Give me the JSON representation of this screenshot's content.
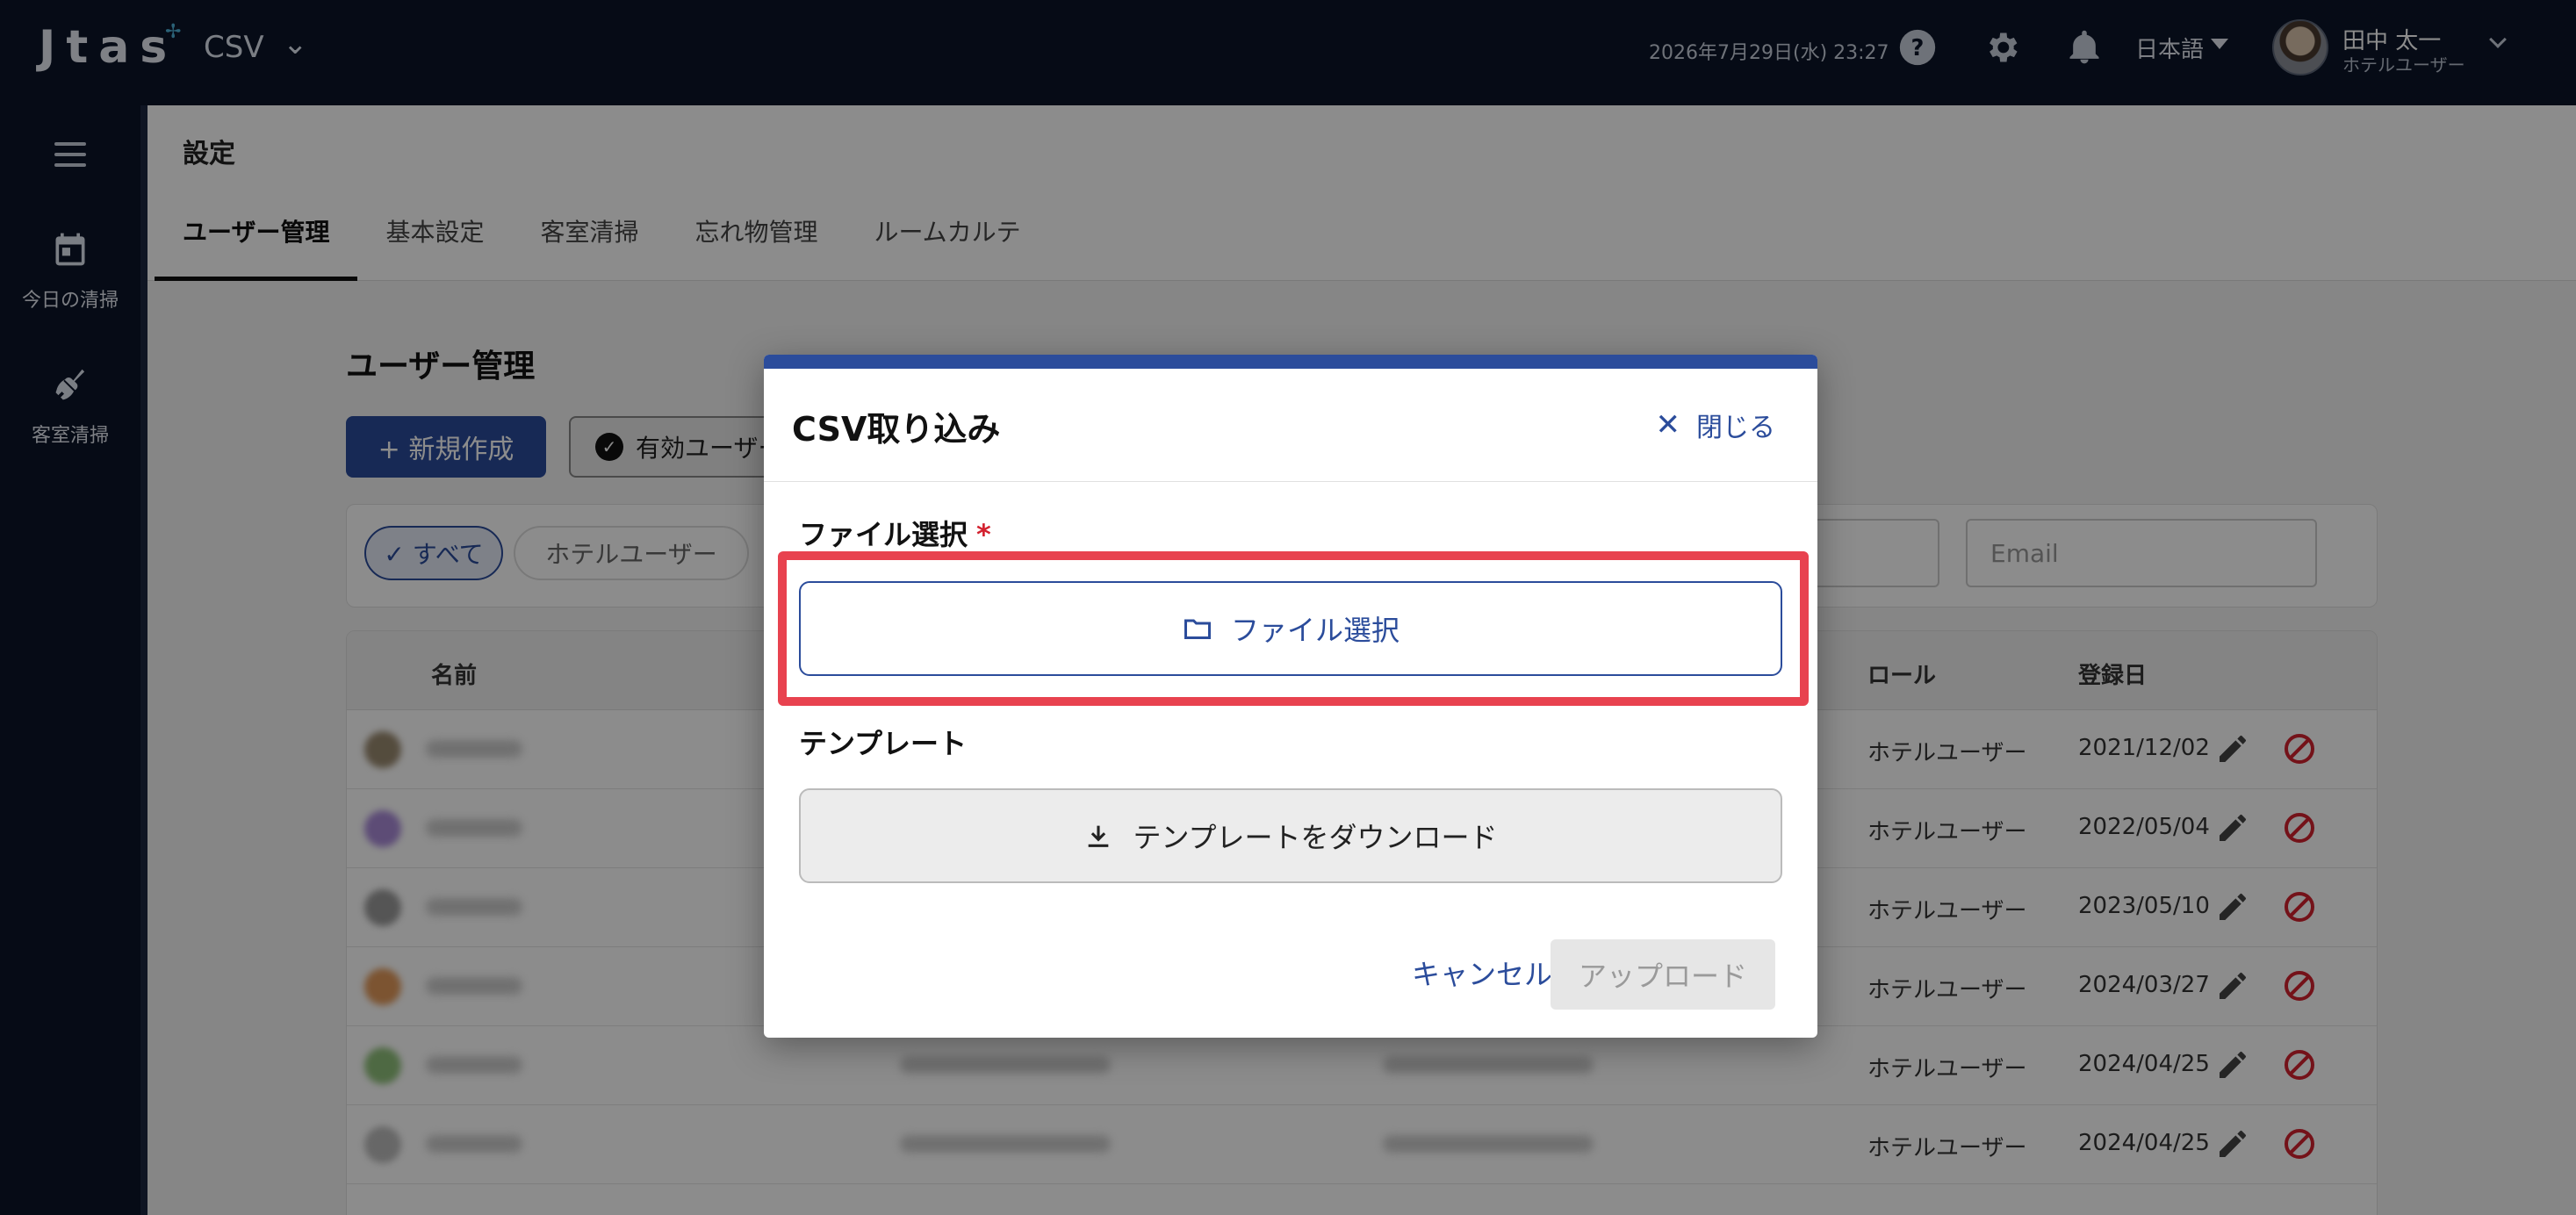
{
  "header": {
    "logo_text": "Jtas",
    "app_name": "CSV",
    "datetime": "2026年7月29日(水) 23:27",
    "language": "日本語",
    "user_name": "田中 太一",
    "user_role": "ホテルユーザー"
  },
  "sidebar": {
    "items": [
      {
        "label": "今日の清掃",
        "icon": "calendar-icon"
      },
      {
        "label": "客室清掃",
        "icon": "broom-icon"
      }
    ]
  },
  "page": {
    "title": "設定",
    "tabs": [
      {
        "label": "ユーザー管理",
        "active": true
      },
      {
        "label": "基本設定",
        "active": false
      },
      {
        "label": "客室清掃",
        "active": false
      },
      {
        "label": "忘れ物管理",
        "active": false
      },
      {
        "label": "ルームカルテ",
        "active": false
      }
    ]
  },
  "users": {
    "section_title": "ユーザー管理",
    "new_button": "+ 新規作成",
    "active_filter": "有効ユーザー",
    "chips": {
      "all": "✓ すべて",
      "hotel": "ホテルユーザー"
    },
    "email_placeholder": "Email",
    "columns": {
      "name": "名前",
      "role": "ロール",
      "registered": "登録日"
    },
    "rows": [
      {
        "role": "ホテルユーザー",
        "date": "2021/12/02"
      },
      {
        "role": "ホテルユーザー",
        "date": "2022/05/04"
      },
      {
        "role": "ホテルユーザー",
        "date": "2023/05/10"
      },
      {
        "role": "ホテルユーザー",
        "date": "2024/03/27"
      },
      {
        "role": "ホテルユーザー",
        "date": "2024/04/25"
      },
      {
        "role": "ホテルユーザー",
        "date": "2024/04/25"
      }
    ]
  },
  "modal": {
    "title": "CSV取り込み",
    "close_label": "閉じる",
    "file_label": "ファイル選択",
    "required_mark": "*",
    "file_button": "ファイル選択",
    "template_label": "テンプレート",
    "download_button": "テンプレートをダウンロード",
    "cancel_button": "キャンセル",
    "upload_button": "アップロード"
  },
  "colors": {
    "nav_bg": "#0b1428",
    "primary": "#2b4c9b",
    "danger": "#d3212f",
    "highlight": "#e8424f"
  }
}
